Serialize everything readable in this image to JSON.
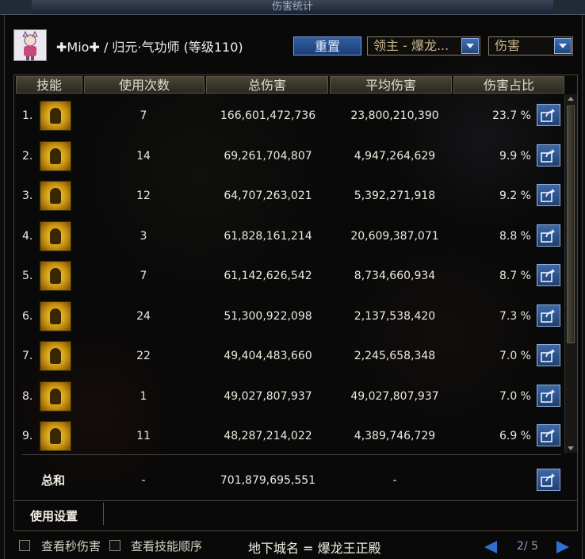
{
  "window": {
    "title": "伤害统计"
  },
  "header": {
    "character": "✚Mio✚ / 归元·气功师 (等级110)",
    "reset_label": "重置",
    "target_select": "领主 - 爆龙...",
    "metric_select": "伤害"
  },
  "table": {
    "headers": [
      "技能",
      "使用次数",
      "总伤害",
      "平均伤害",
      "伤害占比"
    ],
    "rows": [
      {
        "rank": "1.",
        "uses": "7",
        "total": "166,601,472,736",
        "avg": "23,800,210,390",
        "pct": "23.7 %"
      },
      {
        "rank": "2.",
        "uses": "14",
        "total": "69,261,704,807",
        "avg": "4,947,264,629",
        "pct": "9.9 %"
      },
      {
        "rank": "3.",
        "uses": "12",
        "total": "64,707,263,021",
        "avg": "5,392,271,918",
        "pct": "9.2 %"
      },
      {
        "rank": "4.",
        "uses": "3",
        "total": "61,828,161,214",
        "avg": "20,609,387,071",
        "pct": "8.8 %"
      },
      {
        "rank": "5.",
        "uses": "7",
        "total": "61,142,626,542",
        "avg": "8,734,660,934",
        "pct": "8.7 %"
      },
      {
        "rank": "6.",
        "uses": "24",
        "total": "51,300,922,098",
        "avg": "2,137,538,420",
        "pct": "7.3 %"
      },
      {
        "rank": "7.",
        "uses": "22",
        "total": "49,404,483,660",
        "avg": "2,245,658,348",
        "pct": "7.0 %"
      },
      {
        "rank": "8.",
        "uses": "1",
        "total": "49,027,807,937",
        "avg": "49,027,807,937",
        "pct": "7.0 %"
      },
      {
        "rank": "9.",
        "uses": "11",
        "total": "48,287,214,022",
        "avg": "4,389,746,729",
        "pct": "6.9 %"
      }
    ],
    "total_row": {
      "label": "总和",
      "uses": "-",
      "total": "701,879,695,551",
      "avg": "-"
    }
  },
  "settings": {
    "label": "使用设置"
  },
  "footer": {
    "check_per_second": "查看秒伤害",
    "check_skill_order": "查看技能顺序",
    "dungeon": "地下城名 = 爆龙王正殿",
    "page": "2/ 5"
  },
  "icons": [
    "share-icon",
    "dropdown-arrow-icon",
    "skill-icon",
    "avatar-icon"
  ],
  "colors": {
    "accent": "#2f5fa2",
    "header_bg": "#4a4538",
    "page_arrows": "#2f6fd0"
  }
}
